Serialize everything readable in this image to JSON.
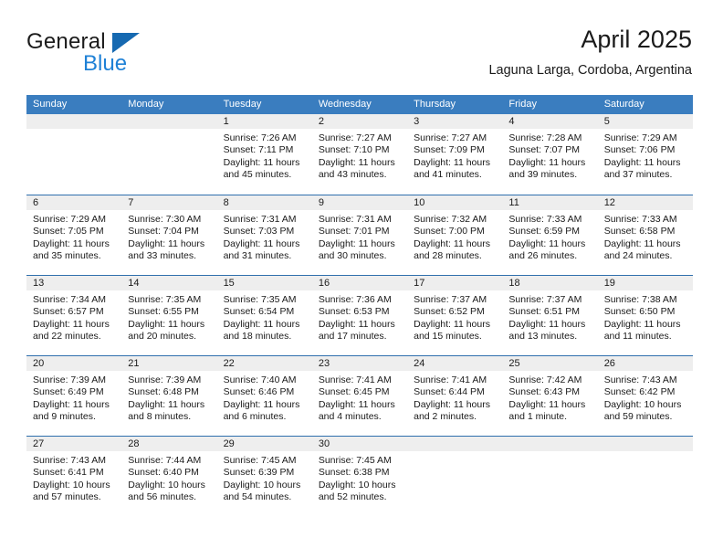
{
  "logo": {
    "word_top": "General",
    "word_bottom": "Blue",
    "triangle_icon": "triangle-icon",
    "brand_blue": "#1f81d6",
    "triangle_color": "#1669b1"
  },
  "header": {
    "title": "April 2025",
    "subtitle": "Laguna Larga, Cordoba, Argentina"
  },
  "theme": {
    "header_bar": "#3a7dbf",
    "row_divider": "#2f6fad",
    "day_strip": "#eeeeee"
  },
  "weekdays": [
    "Sunday",
    "Monday",
    "Tuesday",
    "Wednesday",
    "Thursday",
    "Friday",
    "Saturday"
  ],
  "weeks": [
    [
      {
        "day": "",
        "lines": []
      },
      {
        "day": "",
        "lines": []
      },
      {
        "day": "1",
        "lines": [
          "Sunrise: 7:26 AM",
          "Sunset: 7:11 PM",
          "Daylight: 11 hours",
          "and 45 minutes."
        ]
      },
      {
        "day": "2",
        "lines": [
          "Sunrise: 7:27 AM",
          "Sunset: 7:10 PM",
          "Daylight: 11 hours",
          "and 43 minutes."
        ]
      },
      {
        "day": "3",
        "lines": [
          "Sunrise: 7:27 AM",
          "Sunset: 7:09 PM",
          "Daylight: 11 hours",
          "and 41 minutes."
        ]
      },
      {
        "day": "4",
        "lines": [
          "Sunrise: 7:28 AM",
          "Sunset: 7:07 PM",
          "Daylight: 11 hours",
          "and 39 minutes."
        ]
      },
      {
        "day": "5",
        "lines": [
          "Sunrise: 7:29 AM",
          "Sunset: 7:06 PM",
          "Daylight: 11 hours",
          "and 37 minutes."
        ]
      }
    ],
    [
      {
        "day": "6",
        "lines": [
          "Sunrise: 7:29 AM",
          "Sunset: 7:05 PM",
          "Daylight: 11 hours",
          "and 35 minutes."
        ]
      },
      {
        "day": "7",
        "lines": [
          "Sunrise: 7:30 AM",
          "Sunset: 7:04 PM",
          "Daylight: 11 hours",
          "and 33 minutes."
        ]
      },
      {
        "day": "8",
        "lines": [
          "Sunrise: 7:31 AM",
          "Sunset: 7:03 PM",
          "Daylight: 11 hours",
          "and 31 minutes."
        ]
      },
      {
        "day": "9",
        "lines": [
          "Sunrise: 7:31 AM",
          "Sunset: 7:01 PM",
          "Daylight: 11 hours",
          "and 30 minutes."
        ]
      },
      {
        "day": "10",
        "lines": [
          "Sunrise: 7:32 AM",
          "Sunset: 7:00 PM",
          "Daylight: 11 hours",
          "and 28 minutes."
        ]
      },
      {
        "day": "11",
        "lines": [
          "Sunrise: 7:33 AM",
          "Sunset: 6:59 PM",
          "Daylight: 11 hours",
          "and 26 minutes."
        ]
      },
      {
        "day": "12",
        "lines": [
          "Sunrise: 7:33 AM",
          "Sunset: 6:58 PM",
          "Daylight: 11 hours",
          "and 24 minutes."
        ]
      }
    ],
    [
      {
        "day": "13",
        "lines": [
          "Sunrise: 7:34 AM",
          "Sunset: 6:57 PM",
          "Daylight: 11 hours",
          "and 22 minutes."
        ]
      },
      {
        "day": "14",
        "lines": [
          "Sunrise: 7:35 AM",
          "Sunset: 6:55 PM",
          "Daylight: 11 hours",
          "and 20 minutes."
        ]
      },
      {
        "day": "15",
        "lines": [
          "Sunrise: 7:35 AM",
          "Sunset: 6:54 PM",
          "Daylight: 11 hours",
          "and 18 minutes."
        ]
      },
      {
        "day": "16",
        "lines": [
          "Sunrise: 7:36 AM",
          "Sunset: 6:53 PM",
          "Daylight: 11 hours",
          "and 17 minutes."
        ]
      },
      {
        "day": "17",
        "lines": [
          "Sunrise: 7:37 AM",
          "Sunset: 6:52 PM",
          "Daylight: 11 hours",
          "and 15 minutes."
        ]
      },
      {
        "day": "18",
        "lines": [
          "Sunrise: 7:37 AM",
          "Sunset: 6:51 PM",
          "Daylight: 11 hours",
          "and 13 minutes."
        ]
      },
      {
        "day": "19",
        "lines": [
          "Sunrise: 7:38 AM",
          "Sunset: 6:50 PM",
          "Daylight: 11 hours",
          "and 11 minutes."
        ]
      }
    ],
    [
      {
        "day": "20",
        "lines": [
          "Sunrise: 7:39 AM",
          "Sunset: 6:49 PM",
          "Daylight: 11 hours",
          "and 9 minutes."
        ]
      },
      {
        "day": "21",
        "lines": [
          "Sunrise: 7:39 AM",
          "Sunset: 6:48 PM",
          "Daylight: 11 hours",
          "and 8 minutes."
        ]
      },
      {
        "day": "22",
        "lines": [
          "Sunrise: 7:40 AM",
          "Sunset: 6:46 PM",
          "Daylight: 11 hours",
          "and 6 minutes."
        ]
      },
      {
        "day": "23",
        "lines": [
          "Sunrise: 7:41 AM",
          "Sunset: 6:45 PM",
          "Daylight: 11 hours",
          "and 4 minutes."
        ]
      },
      {
        "day": "24",
        "lines": [
          "Sunrise: 7:41 AM",
          "Sunset: 6:44 PM",
          "Daylight: 11 hours",
          "and 2 minutes."
        ]
      },
      {
        "day": "25",
        "lines": [
          "Sunrise: 7:42 AM",
          "Sunset: 6:43 PM",
          "Daylight: 11 hours",
          "and 1 minute."
        ]
      },
      {
        "day": "26",
        "lines": [
          "Sunrise: 7:43 AM",
          "Sunset: 6:42 PM",
          "Daylight: 10 hours",
          "and 59 minutes."
        ]
      }
    ],
    [
      {
        "day": "27",
        "lines": [
          "Sunrise: 7:43 AM",
          "Sunset: 6:41 PM",
          "Daylight: 10 hours",
          "and 57 minutes."
        ]
      },
      {
        "day": "28",
        "lines": [
          "Sunrise: 7:44 AM",
          "Sunset: 6:40 PM",
          "Daylight: 10 hours",
          "and 56 minutes."
        ]
      },
      {
        "day": "29",
        "lines": [
          "Sunrise: 7:45 AM",
          "Sunset: 6:39 PM",
          "Daylight: 10 hours",
          "and 54 minutes."
        ]
      },
      {
        "day": "30",
        "lines": [
          "Sunrise: 7:45 AM",
          "Sunset: 6:38 PM",
          "Daylight: 10 hours",
          "and 52 minutes."
        ]
      },
      {
        "day": "",
        "lines": []
      },
      {
        "day": "",
        "lines": []
      },
      {
        "day": "",
        "lines": []
      }
    ]
  ]
}
